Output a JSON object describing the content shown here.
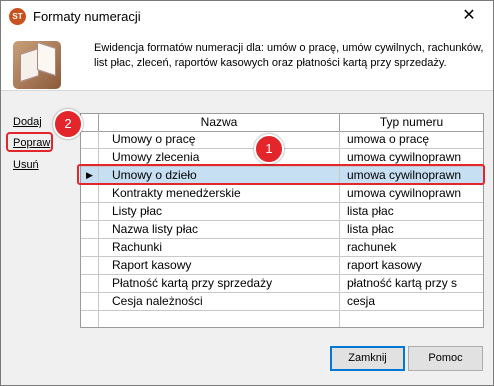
{
  "window": {
    "title": "Formaty numeracji",
    "app_icon": "ST",
    "close_glyph": "✕"
  },
  "header": {
    "description": "Ewidencja formatów numeracji dla: umów o pracę, umów cywilnych, rachunków, list płac, zleceń, raportów kasowych oraz płatności kartą przy sprzedaży."
  },
  "actions": {
    "add": "Dodaj",
    "edit": "Popraw",
    "delete": "Usuń"
  },
  "annotations": {
    "badge1": "1",
    "badge2": "2",
    "highlight_color": "#e2262c"
  },
  "table": {
    "columns": [
      "Nazwa",
      "Typ numeru"
    ],
    "selected_index": 2,
    "rows": [
      {
        "name": "Umowy o pracę",
        "type": "umowa o pracę"
      },
      {
        "name": "Umowy zlecenia",
        "type": "umowa cywilnoprawn"
      },
      {
        "name": "Umowy o dzieło",
        "type": "umowa cywilnoprawn"
      },
      {
        "name": "Kontrakty menedżerskie",
        "type": "umowa cywilnoprawn"
      },
      {
        "name": "Listy płac",
        "type": "lista płac"
      },
      {
        "name": "Nazwa listy płac",
        "type": "lista płac"
      },
      {
        "name": "Rachunki",
        "type": "rachunek"
      },
      {
        "name": "Raport kasowy",
        "type": "raport kasowy"
      },
      {
        "name": "Płatność kartą przy sprzedaży",
        "type": "płatność kartą przy s"
      },
      {
        "name": "Cesja należności",
        "type": "cesja"
      },
      {
        "name": "",
        "type": ""
      }
    ]
  },
  "buttons": {
    "ok": "Zamknij",
    "help": "Pomoc"
  }
}
